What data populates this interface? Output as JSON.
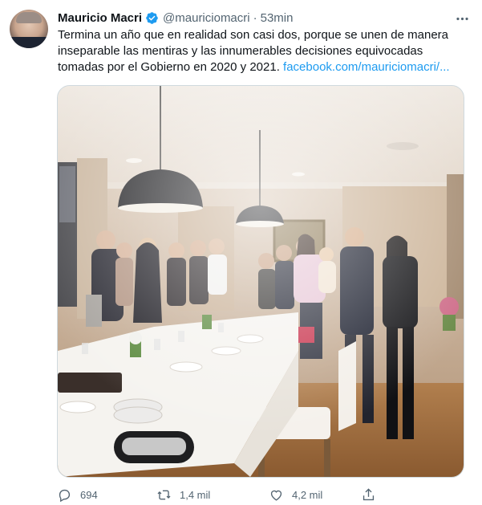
{
  "tweet": {
    "author_name": "Mauricio Macri",
    "handle": "@mauriciomacri",
    "separator": "·",
    "time": "53min",
    "text_line1": "Termina un año que en realidad son casi dos, porque se unen de manera",
    "text_line2": "inseparable las mentiras y las innumerables decisiones equivocadas",
    "text_line3": "tomadas por el Gobierno en 2020 y 2021. ",
    "link_text": "facebook.com/mauriciomacri/..."
  },
  "actions": {
    "reply_count": "694",
    "retweet_count": "1,4 mil",
    "like_count": "4,2 mil"
  },
  "colors": {
    "accent": "#1d9bf0",
    "muted": "#536471",
    "text": "#0f1419"
  },
  "icons": [
    "verified-badge-icon",
    "more-options-icon",
    "reply-icon",
    "retweet-icon",
    "like-icon",
    "share-icon"
  ]
}
